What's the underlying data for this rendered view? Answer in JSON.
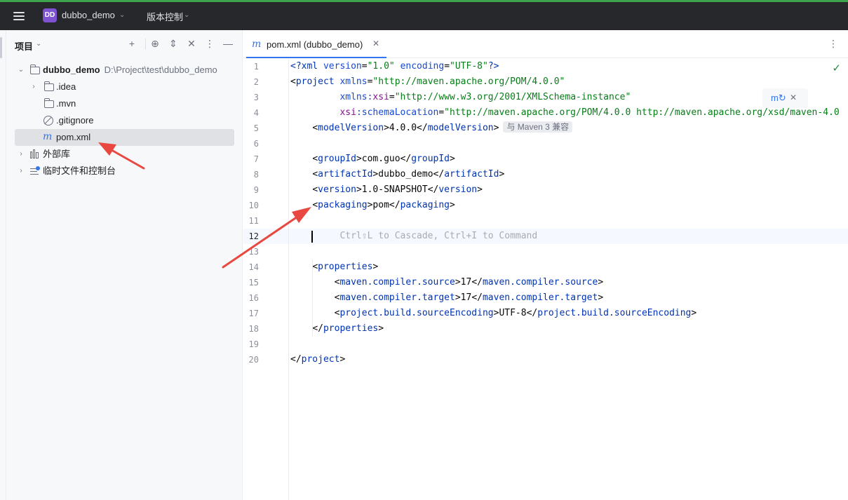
{
  "topbar": {
    "project_badge": "DD",
    "project_name": "dubbo_demo",
    "vcs_label": "版本控制"
  },
  "project_panel": {
    "title": "项目",
    "tree": [
      {
        "label": "dubbo_demo",
        "path": "D:\\Project\\test\\dubbo_demo",
        "icon": "module-folder-icon",
        "expanded": true
      },
      {
        "label": ".idea",
        "icon": "folder-icon",
        "expanded": false
      },
      {
        "label": ".mvn",
        "icon": "folder-icon"
      },
      {
        "label": ".gitignore",
        "icon": "ignore-file-icon"
      },
      {
        "label": "pom.xml",
        "icon": "maven-icon",
        "selected": true
      },
      {
        "label": "外部库",
        "icon": "library-icon",
        "expanded": false
      },
      {
        "label": "临时文件和控制台",
        "icon": "scratches-icon",
        "expanded": false
      }
    ]
  },
  "editor": {
    "tab_label": "pom.xml (dubbo_demo)",
    "line_numbers": [
      "1",
      "2",
      "3",
      "4",
      "5",
      "6",
      "7",
      "8",
      "9",
      "10",
      "11",
      "12",
      "13",
      "14",
      "15",
      "16",
      "17",
      "18",
      "19",
      "20"
    ],
    "current_line": 12,
    "inlay_hint": "与 Maven 3 兼容",
    "ai_hint": "Ctrl⇧L to Cascade, Ctrl+I to Command",
    "code": {
      "l1_decl": "<?xml",
      "l1_version_attr": "version",
      "l1_version_val": "\"1.0\"",
      "l1_encoding_attr": "encoding",
      "l1_encoding_val": "\"UTF-8\"",
      "l1_end": "?>",
      "project_tag": "project",
      "xmlns_attr": "xmlns",
      "xmlns_val": "\"http://maven.apache.org/POM/4.0.0\"",
      "xmlns_xsi_prefix": "xmlns:",
      "xmlns_xsi_name": "xsi",
      "xmlns_xsi_val": "\"http://www.w3.org/2001/XMLSchema-instance\"",
      "schema_prefix": "xsi",
      "schema_name": ":schemaLocation",
      "schema_val": "\"http://maven.apache.org/POM/4.0.0 http://maven.apache.org/xsd/maven-4.0",
      "model_version_tag": "modelVersion",
      "model_version_val": "4.0.0",
      "group_id_tag": "groupId",
      "group_id_val": "com.guo",
      "artifact_id_tag": "artifactId",
      "artifact_id_val": "dubbo_demo",
      "version_tag": "version",
      "version_val": "1.0-SNAPSHOT",
      "packaging_tag": "packaging",
      "packaging_val": "pom",
      "properties_tag": "properties",
      "compiler_source_tag": "maven.compiler.source",
      "compiler_source_val": "17",
      "compiler_target_tag": "maven.compiler.target",
      "compiler_target_val": "17",
      "encoding_tag": "project.build.sourceEncoding",
      "encoding_val": "UTF-8"
    }
  },
  "colors": {
    "accent": "#3574f0",
    "tag": "#0033b3",
    "string": "#067d17",
    "namespace": "#871094",
    "annotation_arrow": "#e8483f"
  }
}
